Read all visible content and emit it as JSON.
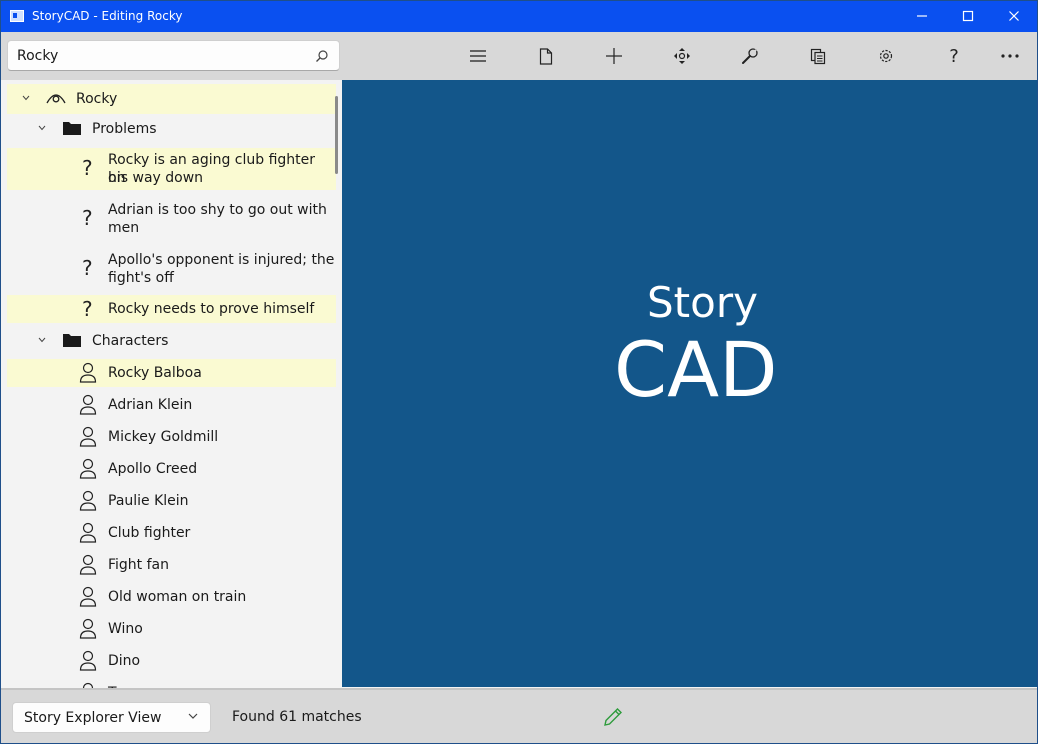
{
  "window": {
    "title": "StoryCAD - Editing Rocky",
    "controls": [
      "minimize-icon",
      "maximize-icon",
      "close-icon"
    ]
  },
  "search": {
    "value": "Rocky",
    "icon": "search-icon"
  },
  "toolbar": {
    "buttons": [
      {
        "name": "menu-icon"
      },
      {
        "name": "file-icon"
      },
      {
        "name": "add-icon"
      },
      {
        "name": "move-icon"
      },
      {
        "name": "tools-icon"
      },
      {
        "name": "reports-icon"
      },
      {
        "name": "settings-icon"
      },
      {
        "name": "help-icon"
      },
      {
        "name": "more-icon"
      }
    ]
  },
  "tree": {
    "root": {
      "label": "Rocky",
      "icon": "eye-icon",
      "highlighted": true
    },
    "problems_folder": {
      "label": "Problems",
      "icon": "folder-icon"
    },
    "problems": [
      {
        "label_line1": "Rocky is an aging club fighter on",
        "label_line2": "his way down",
        "icon": "question-icon",
        "highlighted": true
      },
      {
        "label_line1": "Adrian is too shy to go out with",
        "label_line2": "men",
        "icon": "question-icon",
        "highlighted": false
      },
      {
        "label_line1": "Apollo's opponent is injured; the",
        "label_line2": "fight's off",
        "icon": "question-icon",
        "highlighted": false
      },
      {
        "label_line1": "Rocky needs to prove himself",
        "label_line2": "",
        "icon": "question-icon",
        "highlighted": true
      }
    ],
    "characters_folder": {
      "label": "Characters",
      "icon": "folder-icon"
    },
    "characters": [
      {
        "label": "Rocky Balboa",
        "highlighted": true
      },
      {
        "label": "Adrian Klein",
        "highlighted": false
      },
      {
        "label": "Mickey Goldmill",
        "highlighted": false
      },
      {
        "label": "Apollo Creed",
        "highlighted": false
      },
      {
        "label": "Paulie Klein",
        "highlighted": false
      },
      {
        "label": "Club fighter",
        "highlighted": false
      },
      {
        "label": "Fight fan",
        "highlighted": false
      },
      {
        "label": "Old woman on train",
        "highlighted": false
      },
      {
        "label": "Wino",
        "highlighted": false
      },
      {
        "label": "Dino",
        "highlighted": false
      },
      {
        "label": "T",
        "highlighted": false
      }
    ]
  },
  "splash": {
    "line1": "Story",
    "line2": "CAD",
    "background": "#13568a"
  },
  "status": {
    "view_select": "Story Explorer View",
    "message": "Found 61 matches",
    "edit_icon": "pencil-icon",
    "edit_color": "#2e9b3c"
  },
  "colors": {
    "titlebar": "#0a50f0",
    "highlight": "#fafad2",
    "toolbar": "#d8d8d8"
  }
}
